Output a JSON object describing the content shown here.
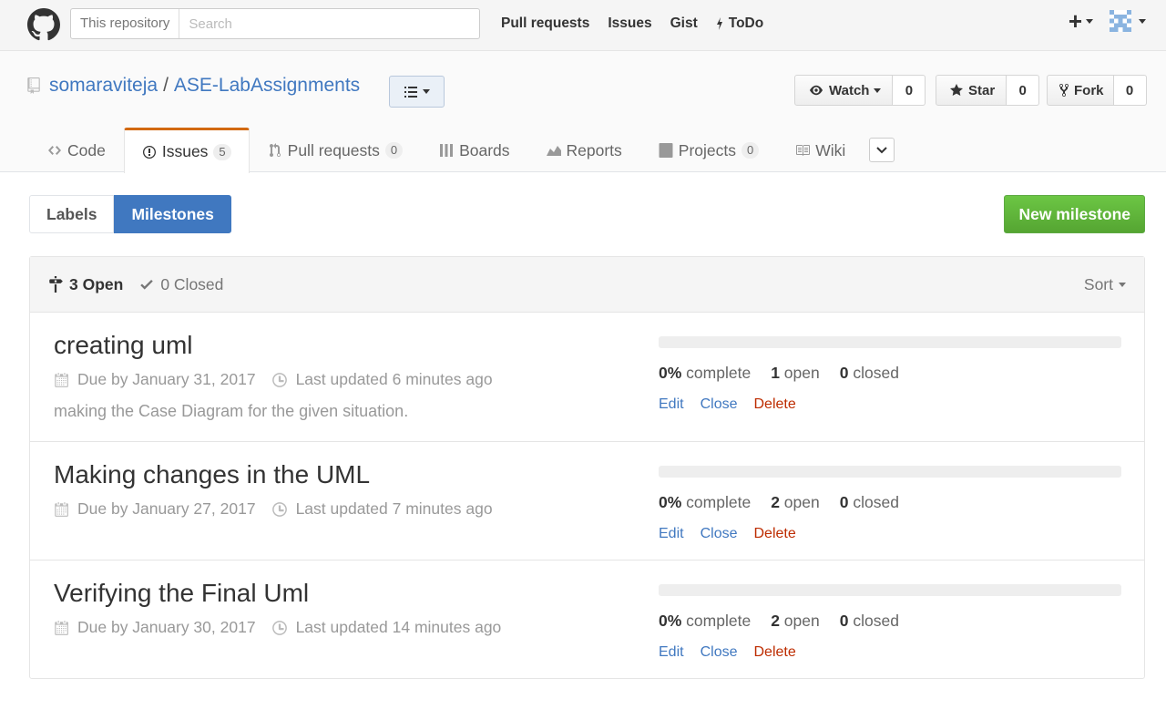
{
  "header": {
    "scope_label": "This repository",
    "search_placeholder": "Search",
    "nav": {
      "pull_requests": "Pull requests",
      "issues": "Issues",
      "gist": "Gist",
      "todo": "ToDo"
    }
  },
  "repo": {
    "owner": "somaraviteja",
    "separator": "/",
    "name": "ASE-LabAssignments",
    "watch": {
      "label": "Watch",
      "count": "0"
    },
    "star": {
      "label": "Star",
      "count": "0"
    },
    "fork": {
      "label": "Fork",
      "count": "0"
    }
  },
  "reponav": {
    "code": {
      "label": "Code"
    },
    "issues": {
      "label": "Issues",
      "count": "5"
    },
    "pull_requests": {
      "label": "Pull requests",
      "count": "0"
    },
    "boards": {
      "label": "Boards"
    },
    "reports": {
      "label": "Reports"
    },
    "projects": {
      "label": "Projects",
      "count": "0"
    },
    "wiki": {
      "label": "Wiki"
    }
  },
  "subnav": {
    "labels": "Labels",
    "milestones": "Milestones",
    "new_milestone": "New milestone"
  },
  "milestones_header": {
    "open": "3 Open",
    "closed": "0 Closed",
    "sort": "Sort"
  },
  "milestones": [
    {
      "title": "creating uml",
      "due": "Due by January 31, 2017",
      "updated": "Last updated 6 minutes ago",
      "description": "making the Case Diagram for the given situation.",
      "progress": 0,
      "percent": "0%",
      "complete_label": "complete",
      "open_count": "1",
      "open_label": "open",
      "closed_count": "0",
      "closed_label": "closed",
      "actions": {
        "edit": "Edit",
        "close": "Close",
        "delete": "Delete"
      }
    },
    {
      "title": "Making changes in the UML",
      "due": "Due by January 27, 2017",
      "updated": "Last updated 7 minutes ago",
      "description": "",
      "progress": 0,
      "percent": "0%",
      "complete_label": "complete",
      "open_count": "2",
      "open_label": "open",
      "closed_count": "0",
      "closed_label": "closed",
      "actions": {
        "edit": "Edit",
        "close": "Close",
        "delete": "Delete"
      }
    },
    {
      "title": "Verifying the Final Uml",
      "due": "Due by January 30, 2017",
      "updated": "Last updated 14 minutes ago",
      "description": "",
      "progress": 0,
      "percent": "0%",
      "complete_label": "complete",
      "open_count": "2",
      "open_label": "open",
      "closed_count": "0",
      "closed_label": "closed",
      "actions": {
        "edit": "Edit",
        "close": "Close",
        "delete": "Delete"
      }
    }
  ],
  "colors": {
    "link": "#4078c0",
    "selected_tab_accent": "#d26911",
    "new_button": "#6cc644",
    "danger": "#bd2c00"
  },
  "icons": [
    "github-logo-icon",
    "plus-icon",
    "avatar-icon",
    "repo-icon",
    "list-icon",
    "eye-icon",
    "star-icon",
    "fork-icon",
    "code-icon",
    "issue-icon",
    "pull-request-icon",
    "boards-icon",
    "reports-icon",
    "projects-icon",
    "wiki-icon",
    "chevron-down-icon",
    "milestone-icon",
    "check-icon",
    "calendar-icon",
    "clock-icon"
  ]
}
